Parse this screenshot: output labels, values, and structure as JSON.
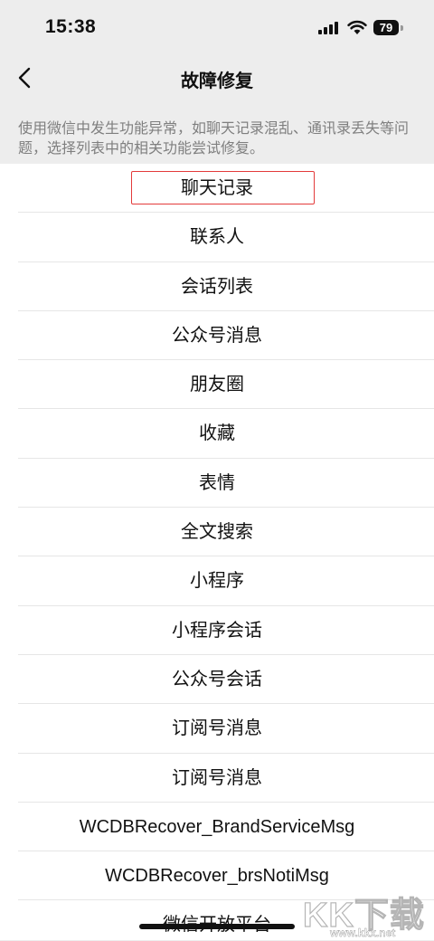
{
  "status_bar": {
    "time": "15:38",
    "battery": "79"
  },
  "nav": {
    "title": "故障修复",
    "back_icon": "chevron-left-icon"
  },
  "description": "使用微信中发生功能异常，如聊天记录混乱、通讯录丢失等问题，选择列表中的相关功能尝试修复。",
  "list_items": [
    "聊天记录",
    "联系人",
    "会话列表",
    "公众号消息",
    "朋友圈",
    "收藏",
    "表情",
    "全文搜索",
    "小程序",
    "小程序会话",
    "公众号会话",
    "订阅号消息",
    "订阅号消息",
    "WCDBRecover_BrandServiceMsg",
    "WCDBRecover_brsNotiMsg",
    "微信开放平台"
  ],
  "watermark": {
    "logo": "KK下载",
    "url": "www.kkx.net"
  },
  "colors": {
    "background": "#ededed",
    "highlight": "#e33b3b",
    "description_text": "#7f7f7f"
  }
}
